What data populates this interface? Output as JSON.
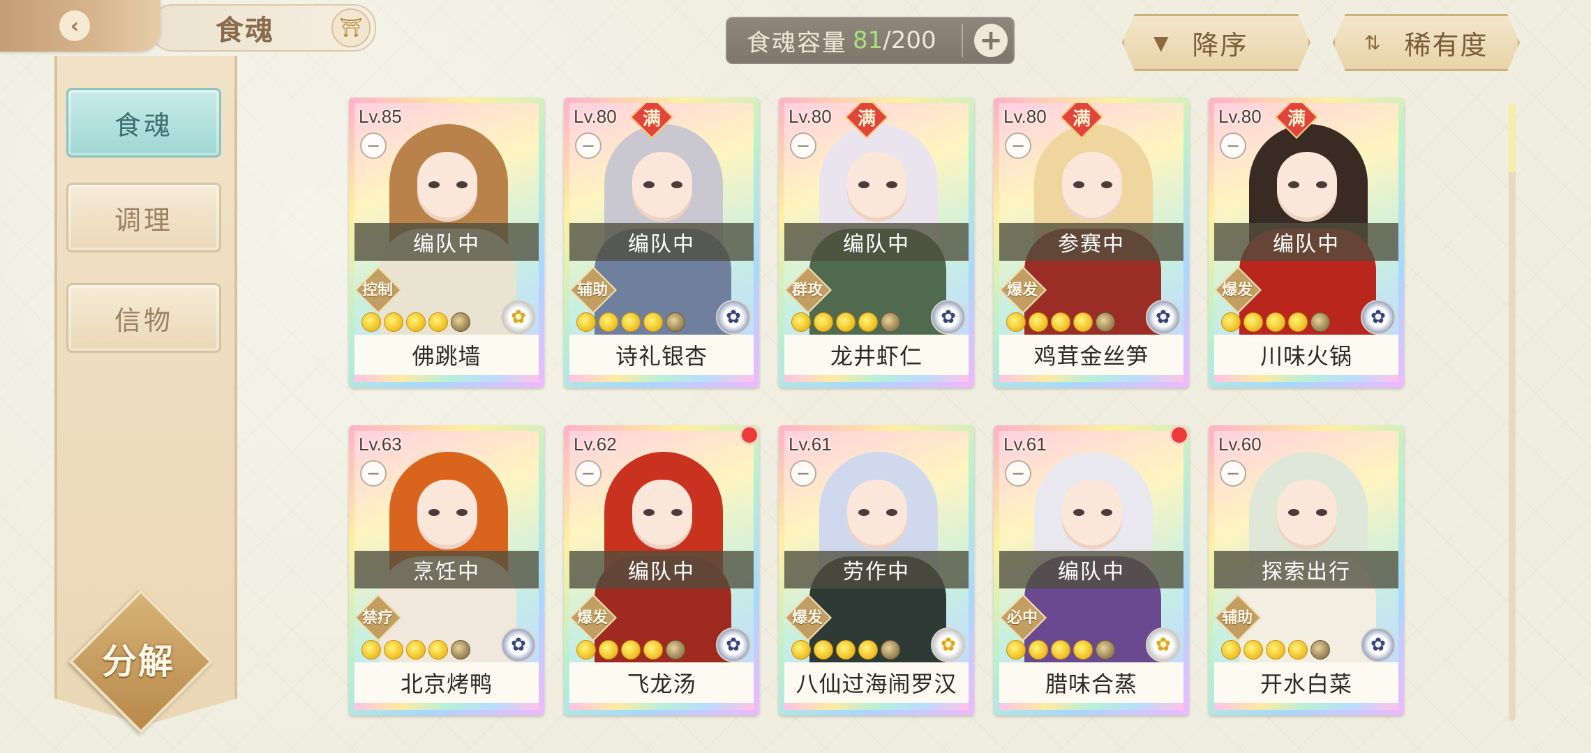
{
  "header": {
    "title": "食魂"
  },
  "capacity": {
    "label": "食魂容量",
    "current": "81",
    "separator": "/",
    "max": "200",
    "add_symbol": "+"
  },
  "sort": {
    "order_label": "降序",
    "rarity_label": "稀有度"
  },
  "sidebar": {
    "items": [
      {
        "label": "食魂",
        "active": true
      },
      {
        "label": "调理",
        "active": false
      },
      {
        "label": "信物",
        "active": false
      }
    ],
    "decompose_label": "分解"
  },
  "cards": [
    {
      "level": "Lv.85",
      "max": "",
      "status": "编队中",
      "role": "控制",
      "stars": 5,
      "name": "佛跳墙",
      "element_icon": "gold-flower-icon",
      "hair": "#b8824a",
      "body": "#e9e4d2"
    },
    {
      "level": "Lv.80",
      "max": "满",
      "status": "编队中",
      "role": "辅助",
      "stars": 5,
      "name": "诗礼银杏",
      "element_icon": "blue-flower-icon",
      "hair": "#c9c7cf",
      "body": "#6f7f9e"
    },
    {
      "level": "Lv.80",
      "max": "满",
      "status": "编队中",
      "role": "群攻",
      "stars": 5,
      "name": "龙井虾仁",
      "element_icon": "blue-flower-icon",
      "hair": "#eae4ee",
      "body": "#4f6a4e"
    },
    {
      "level": "Lv.80",
      "max": "满",
      "status": "参赛中",
      "role": "爆发",
      "stars": 5,
      "name": "鸡茸金丝笋",
      "element_icon": "blue-flower-icon",
      "hair": "#efd59e",
      "body": "#9a2e26"
    },
    {
      "level": "Lv.80",
      "max": "满",
      "status": "编队中",
      "role": "爆发",
      "stars": 5,
      "name": "川味火锅",
      "element_icon": "blue-flower-icon",
      "hair": "#3a2a24",
      "body": "#b8261e"
    },
    {
      "level": "Lv.63",
      "max": "",
      "status": "烹饪中",
      "role": "禁疗",
      "stars": 5,
      "name": "北京烤鸭",
      "element_icon": "blue-flower-icon",
      "hair": "#d8641e",
      "body": "#f0e8dc"
    },
    {
      "level": "Lv.62",
      "max": "",
      "status": "编队中",
      "role": "爆发",
      "stars": 5,
      "name": "飞龙汤",
      "element_icon": "blue-flower-icon",
      "hair": "#c8321e",
      "body": "#9e2a20"
    },
    {
      "level": "Lv.61",
      "max": "",
      "status": "劳作中",
      "role": "爆发",
      "stars": 5,
      "name": "八仙过海闹罗汉",
      "element_icon": "gold-flower-icon",
      "hair": "#d0d8ee",
      "body": "#2e3a36"
    },
    {
      "level": "Lv.61",
      "max": "",
      "status": "编队中",
      "role": "必中",
      "stars": 5,
      "name": "腊味合蒸",
      "element_icon": "gold-flower-icon",
      "hair": "#e8e8ee",
      "body": "#6a4a8e"
    },
    {
      "level": "Lv.60",
      "max": "",
      "status": "探索出行",
      "role": "辅助",
      "stars": 5,
      "name": "开水白菜",
      "element_icon": "blue-flower-icon",
      "hair": "#dfe8d8",
      "body": "#f2eee2"
    }
  ],
  "card_new_flags": [
    false,
    false,
    false,
    false,
    false,
    false,
    true,
    false,
    true,
    false
  ]
}
